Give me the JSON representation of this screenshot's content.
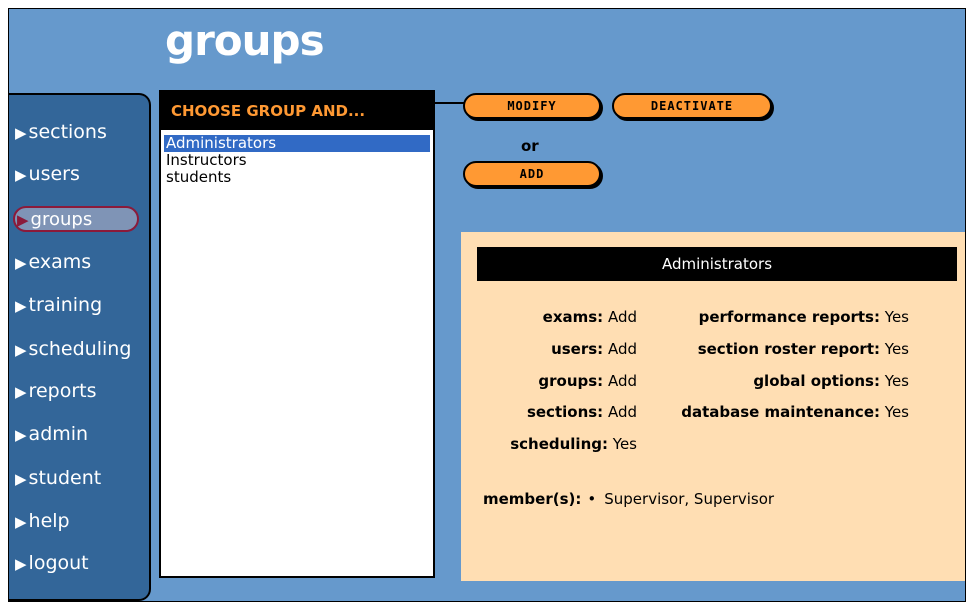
{
  "page": {
    "title": "groups"
  },
  "sidebar": {
    "items": [
      {
        "label": "sections"
      },
      {
        "label": "users"
      },
      {
        "label": "groups"
      },
      {
        "label": "exams"
      },
      {
        "label": "training"
      },
      {
        "label": "scheduling"
      },
      {
        "label": "reports"
      },
      {
        "label": "admin"
      },
      {
        "label": "student"
      },
      {
        "label": "help"
      },
      {
        "label": "logout"
      }
    ],
    "active": "groups"
  },
  "groups_panel": {
    "header": "CHOOSE GROUP AND...",
    "items": [
      "Administrators",
      "Instructors",
      "students"
    ],
    "selected": "Administrators"
  },
  "actions": {
    "modify_label": "MODIFY",
    "deactivate_label": "DEACTIVATE",
    "or_label": "or",
    "add_label": "ADD"
  },
  "details": {
    "title": "Administrators",
    "left_permissions": [
      {
        "label": "exams:",
        "value": "Add"
      },
      {
        "label": "users:",
        "value": "Add"
      },
      {
        "label": "groups:",
        "value": "Add"
      },
      {
        "label": "sections:",
        "value": "Add"
      },
      {
        "label": "scheduling:",
        "value": "Yes"
      }
    ],
    "right_permissions": [
      {
        "label": "performance reports:",
        "value": "Yes"
      },
      {
        "label": "section roster report:",
        "value": "Yes"
      },
      {
        "label": "global options:",
        "value": "Yes"
      },
      {
        "label": "database maintenance:",
        "value": "Yes"
      }
    ],
    "members_label": "member(s):",
    "members": [
      "Supervisor, Supervisor"
    ]
  },
  "colors": {
    "background": "#6699cc",
    "sidebar": "#336699",
    "button": "#ff9933",
    "header_text": "#ff9933",
    "detail_panel": "#ffdeb3",
    "active_nav_border": "#8b1a3a"
  }
}
